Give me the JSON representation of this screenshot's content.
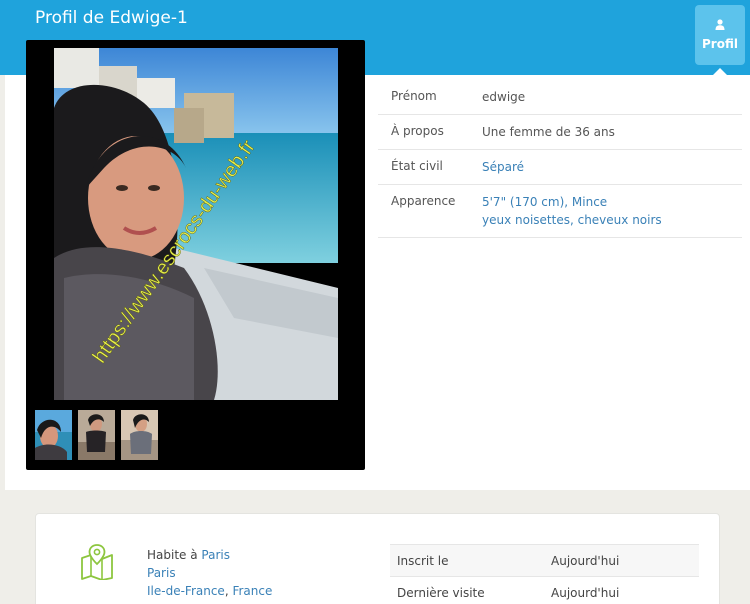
{
  "header": {
    "title": "Profil de Edwige-1",
    "profile_tab_label": "Profil",
    "background_color": "#1fa3dc"
  },
  "photos": {
    "main_alt": "Photo de profil",
    "watermark": "https://www.escrocs-du-web.fr",
    "thumbnail_count": 3
  },
  "info": [
    {
      "label": "Prénom",
      "value_lines": [
        "edwige"
      ],
      "linked": false
    },
    {
      "label": "À propos",
      "value_lines": [
        "Une femme de 36 ans"
      ],
      "linked": false
    },
    {
      "label": "État civil",
      "value_lines": [
        "Séparé"
      ],
      "linked": true
    },
    {
      "label": "Apparence",
      "value_lines": [
        "5'7\" (170 cm), Mince",
        "yeux noisettes, cheveux noirs"
      ],
      "linked": true
    }
  ],
  "location": {
    "lives_in_prefix": "Habite à",
    "city": "Paris",
    "line2": "Paris",
    "region": "Ile-de-France",
    "country": "France"
  },
  "stats": [
    {
      "label": "Inscrit le",
      "value": "Aujourd'hui"
    },
    {
      "label": "Dernière visite",
      "value": "Aujourd'hui"
    }
  ]
}
